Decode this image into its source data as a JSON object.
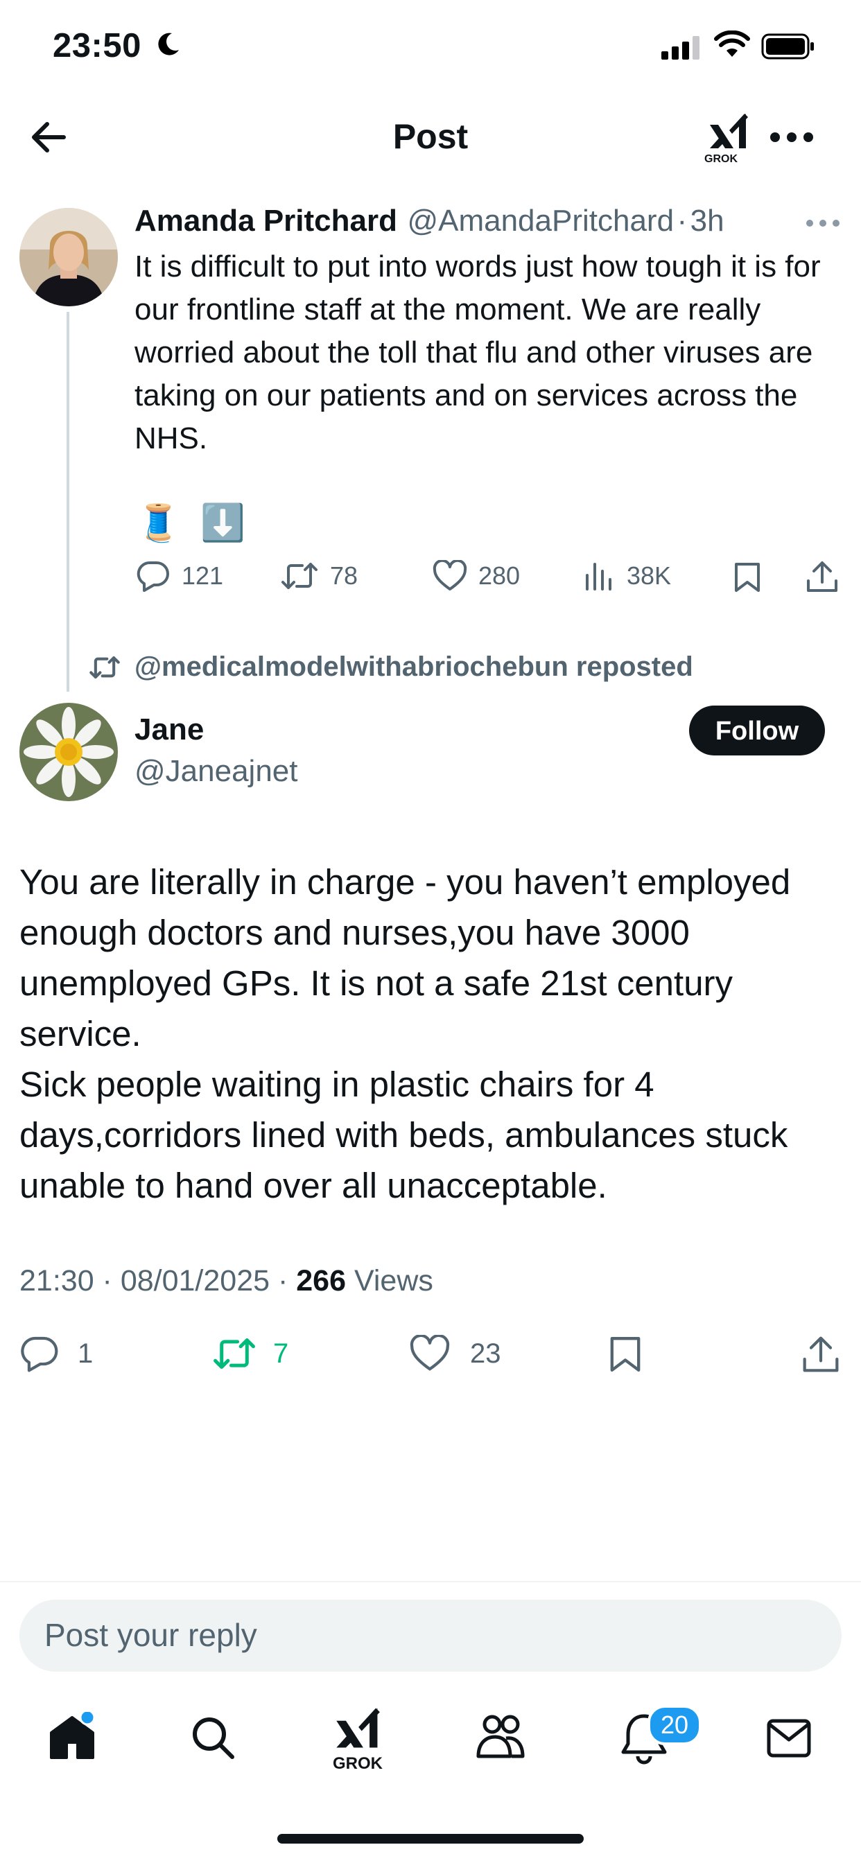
{
  "status_bar": {
    "time": "23:50"
  },
  "header": {
    "title": "Post",
    "grok_label": "GROK"
  },
  "parent_post": {
    "name": "Amanda Pritchard",
    "handle": "@AmandaPritchard",
    "separator": "·",
    "age": "3h",
    "text": "It is difficult to put into words just how tough it is for our frontline staff at the moment. We are really worried about the toll that flu and other viruses are taking on our patients and on services across the NHS.",
    "emojis": [
      "🧵",
      "⬇️"
    ],
    "replies": "121",
    "reposts": "78",
    "likes": "280",
    "views": "38K"
  },
  "repost_context": {
    "text": "@medicalmodelwithabriochebun reposted"
  },
  "main_post": {
    "name": "Jane",
    "handle": "@Janeajnet",
    "follow_label": "Follow",
    "paragraph_1": "You are literally in charge - you haven’t employed enough doctors and nurses,you have 3000 unemployed GPs. It is not a safe 21st century service.",
    "paragraph_2": "Sick people waiting in plastic chairs for 4 days,corridors lined with beds, ambulances stuck unable to hand over all unacceptable.",
    "timestamp": "21:30 · 08/01/2025 · ",
    "views_count": "266",
    "views_label": " Views",
    "replies": "1",
    "reposts": "7",
    "likes": "23"
  },
  "reply_bar": {
    "placeholder": "Post your reply"
  },
  "tab_bar": {
    "grok_label": "GROK",
    "notifications_badge": "20"
  },
  "colors": {
    "accent": "#1d9bf0",
    "repost_active": "#00ba7c",
    "text": "#0f1419",
    "secondary": "#536471"
  }
}
